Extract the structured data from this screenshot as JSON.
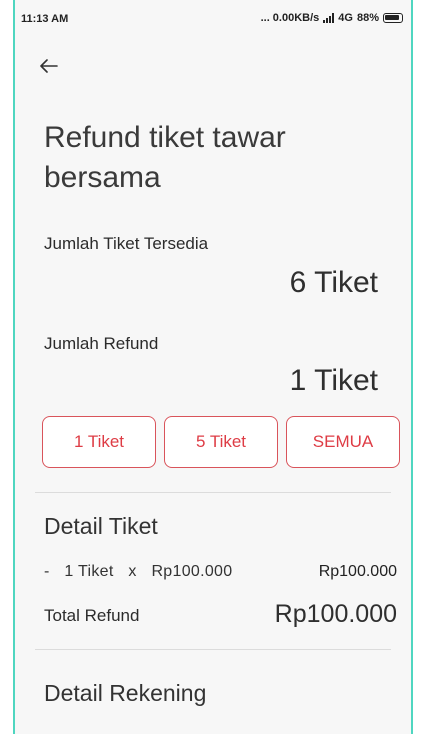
{
  "status_bar": {
    "time": "11:13 AM",
    "network": "... 0.00KB/s",
    "net_type": "4G",
    "battery": "88%"
  },
  "header": {
    "back_icon": "arrow-left-icon",
    "title": "Refund tiket tawar bersama"
  },
  "available": {
    "label": "Jumlah Tiket Tersedia",
    "value": "6 Tiket"
  },
  "refund": {
    "label": "Jumlah Refund",
    "value": "1 Tiket"
  },
  "quick_options": [
    {
      "label": "1 Tiket"
    },
    {
      "label": "5 Tiket"
    },
    {
      "label": "SEMUA"
    }
  ],
  "ticket_detail": {
    "title": "Detail Tiket",
    "bullet": "-",
    "qty": "1 Tiket",
    "times": "x",
    "unit_price": "Rp100.000",
    "line_total": "Rp100.000",
    "total_label": "Total Refund",
    "total_value": "Rp100.000"
  },
  "account_detail": {
    "title": "Detail Rekening"
  },
  "colors": {
    "accent": "#de3c45",
    "frame": "#4fd6c0",
    "background": "#f7f7f7"
  }
}
